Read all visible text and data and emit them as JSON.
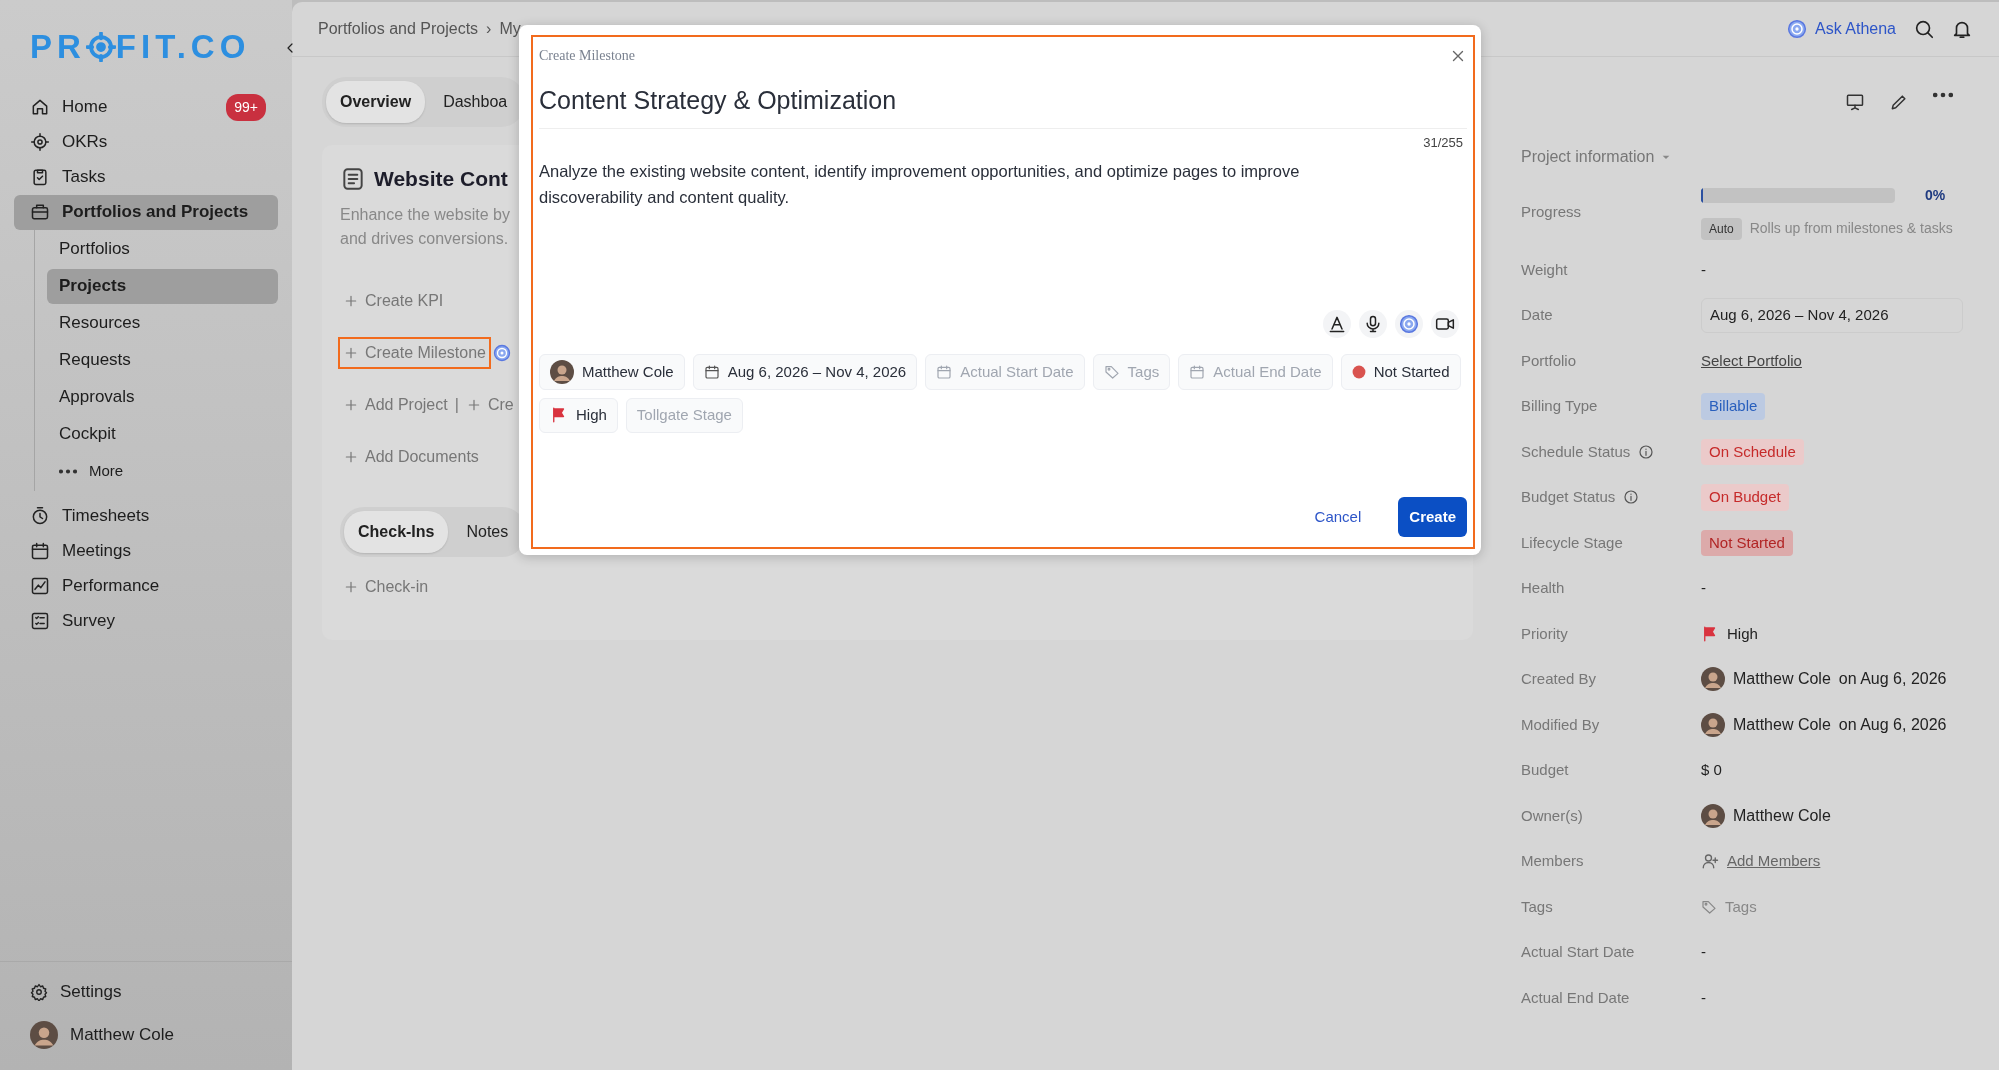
{
  "sidebar": {
    "logo": {
      "before": "PR",
      "after": "FIT.CO"
    },
    "items": [
      {
        "label": "Home",
        "badge": "99+",
        "selected": false
      },
      {
        "label": "OKRs",
        "selected": false
      },
      {
        "label": "Tasks",
        "selected": false
      },
      {
        "label": "Portfolios and Projects",
        "selected": true,
        "children": [
          {
            "label": "Portfolios",
            "selected": false
          },
          {
            "label": "Projects",
            "selected": true
          },
          {
            "label": "Resources",
            "selected": false
          },
          {
            "label": "Requests",
            "selected": false
          },
          {
            "label": "Approvals",
            "selected": false
          },
          {
            "label": "Cockpit",
            "selected": false
          },
          {
            "label": "More",
            "kind": "more",
            "selected": false
          }
        ]
      },
      {
        "label": "Timesheets",
        "selected": false
      },
      {
        "label": "Meetings",
        "selected": false
      },
      {
        "label": "Performance",
        "selected": false
      },
      {
        "label": "Survey",
        "selected": false
      }
    ],
    "footer": {
      "settings": "Settings",
      "user": "Matthew Cole"
    }
  },
  "topbar": {
    "breadcrumb": [
      "Portfolios and Projects",
      "My"
    ],
    "separator": "›",
    "ask": "Ask Athena"
  },
  "tabs": [
    {
      "label": "Overview",
      "selected": true
    },
    {
      "label": "Dashboa",
      "selected": false
    }
  ],
  "project": {
    "title": "Website Cont",
    "description_lines": [
      "Enhance the website by",
      "and drives conversions."
    ],
    "actions": [
      {
        "label": "Create KPI",
        "highlighted": false
      },
      {
        "label": "Create Milestone",
        "highlighted": true,
        "ai": true
      },
      {
        "label": "Add Project",
        "separator": "|",
        "extra": "Cre",
        "highlighted": false
      },
      {
        "label": "Add Documents",
        "highlighted": false
      }
    ],
    "bottom_tabs": [
      {
        "label": "Check-Ins",
        "selected": true
      },
      {
        "label": "Notes",
        "selected": false
      }
    ],
    "checkin": "Check-in"
  },
  "info": {
    "heading": "Project information",
    "rows": [
      {
        "label": "Progress",
        "kind": "progress",
        "level": 0,
        "value": "0%",
        "auto": "Auto",
        "note": "Rolls up from milestones & tasks"
      },
      {
        "label": "Weight",
        "kind": "text",
        "value": "-"
      },
      {
        "label": "Date",
        "kind": "date",
        "value": "Aug 6, 2026 – Nov 4, 2026"
      },
      {
        "label": "Portfolio",
        "kind": "link",
        "value": "Select Portfolio"
      },
      {
        "label": "Billing Type",
        "kind": "badge",
        "value": "Billable",
        "color": "#bccae2"
      },
      {
        "label": "Schedule Status",
        "kind": "badge",
        "info": true,
        "value": "On Schedule",
        "color": "#ebcaca"
      },
      {
        "label": "Budget Status",
        "kind": "badge",
        "info": true,
        "value": "On Budget",
        "color": "#ebcaca"
      },
      {
        "label": "Lifecycle Stage",
        "kind": "badge",
        "value": "Not Started",
        "color": "#dcaaaa"
      },
      {
        "label": "Health",
        "kind": "text",
        "value": "-"
      },
      {
        "label": "Priority",
        "kind": "priority",
        "value": "High"
      },
      {
        "label": "Created By",
        "kind": "user",
        "value": "Matthew Cole",
        "note": "on Aug 6, 2026"
      },
      {
        "label": "Modified By",
        "kind": "user",
        "value": "Matthew Cole",
        "note": "on Aug 6, 2026"
      },
      {
        "label": "Budget",
        "kind": "text",
        "value": "$ 0"
      },
      {
        "label": "Owner(s)",
        "kind": "user",
        "value": "Matthew Cole"
      },
      {
        "label": "Members",
        "kind": "members",
        "value": "Add Members"
      },
      {
        "label": "Tags",
        "kind": "tags",
        "value": "Tags"
      },
      {
        "label": "Actual Start Date",
        "kind": "text",
        "value": "-"
      },
      {
        "label": "Actual End Date",
        "kind": "text",
        "value": "-"
      }
    ]
  },
  "modal": {
    "caption": "Create Milestone",
    "title": "Content Strategy & Optimization",
    "counter": "31/255",
    "description": "Analyze the existing website content, identify improvement opportunities, and optimize pages to improve discoverability and content quality.",
    "chips": [
      {
        "kind": "user",
        "text": "Matthew Cole"
      },
      {
        "kind": "date",
        "text": "Aug 6, 2026 – Nov 4, 2026",
        "filled": true
      },
      {
        "kind": "date",
        "text": "Actual Start Date",
        "filled": false
      },
      {
        "kind": "tags",
        "text": "Tags",
        "filled": false
      },
      {
        "kind": "date",
        "text": "Actual End Date",
        "filled": false
      },
      {
        "kind": "status",
        "text": "Not Started",
        "color": "#d9534f"
      },
      {
        "kind": "priority",
        "text": "High"
      },
      {
        "kind": "plain",
        "text": "Tollgate Stage",
        "filled": false
      }
    ],
    "cancel": "Cancel",
    "create": "Create"
  }
}
